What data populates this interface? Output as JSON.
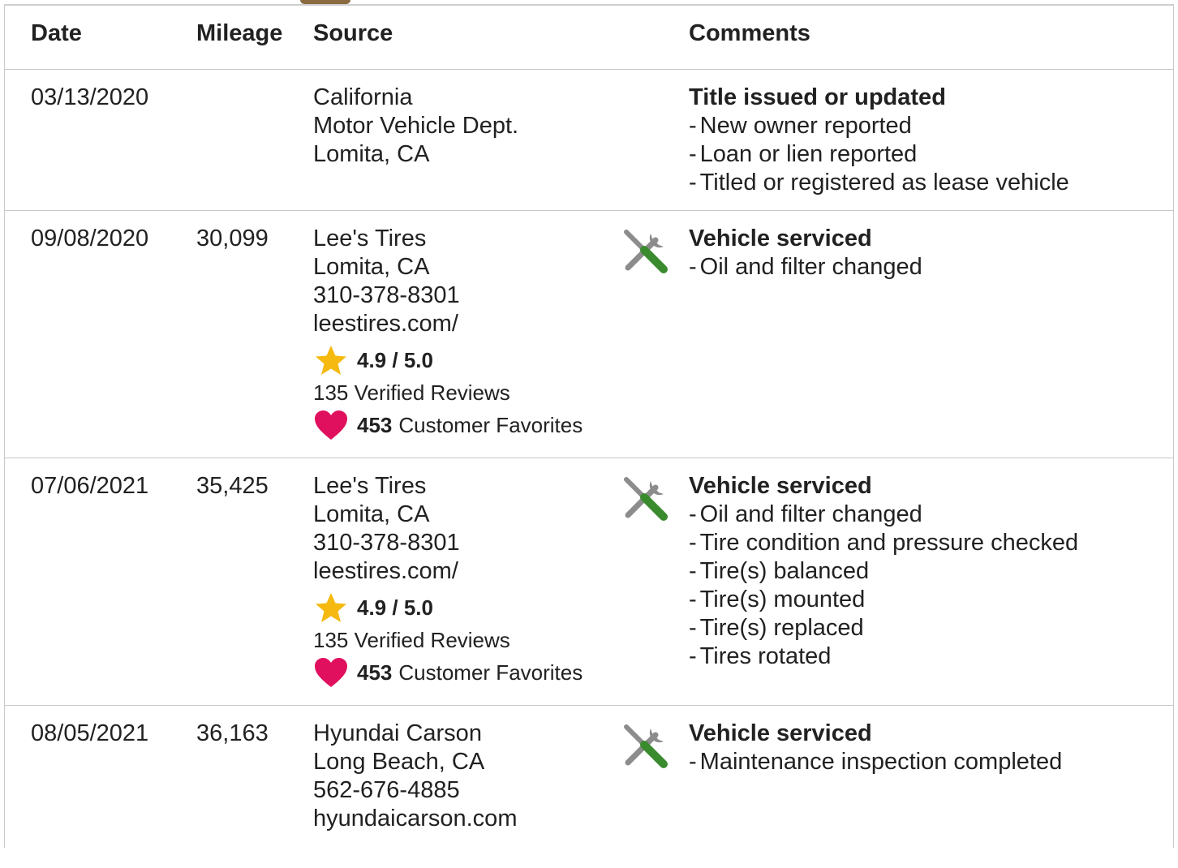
{
  "header": {
    "date": "Date",
    "mileage": "Mileage",
    "source": "Source",
    "comments": "Comments"
  },
  "records": [
    {
      "date": "03/13/2020",
      "mileage": "",
      "source": [
        "California",
        "Motor Vehicle Dept.",
        "Lomita, CA"
      ],
      "title": "Title issued or updated",
      "items": [
        "New owner reported",
        "Loan or lien reported",
        "Titled or registered as lease vehicle"
      ]
    },
    {
      "date": "09/08/2020",
      "mileage": "30,099",
      "source": [
        "Lee's Tires",
        "Lomita, CA",
        "310-378-8301",
        "leestires.com/"
      ],
      "rating": "4.9 / 5.0",
      "reviews": "135 Verified Reviews",
      "favorites_count": "453",
      "favorites_label": "Customer Favorites",
      "title": "Vehicle serviced",
      "items": [
        "Oil and filter changed"
      ]
    },
    {
      "date": "07/06/2021",
      "mileage": "35,425",
      "source": [
        "Lee's Tires",
        "Lomita, CA",
        "310-378-8301",
        "leestires.com/"
      ],
      "rating": "4.9 / 5.0",
      "reviews": "135 Verified Reviews",
      "favorites_count": "453",
      "favorites_label": "Customer Favorites",
      "title": "Vehicle serviced",
      "items": [
        "Oil and filter changed",
        "Tire condition and pressure checked",
        "Tire(s) balanced",
        "Tire(s) mounted",
        "Tire(s) replaced",
        "Tires rotated"
      ]
    },
    {
      "date": "08/05/2021",
      "mileage": "36,163",
      "source": [
        "Hyundai Carson",
        "Long Beach, CA",
        "562-676-4885",
        "hyundaicarson.com"
      ],
      "title": "Vehicle serviced",
      "items": [
        "Maintenance inspection completed"
      ]
    }
  ],
  "item_prefix": "-",
  "icons": {
    "star": "star-icon",
    "heart": "heart-icon",
    "service": "wrench-screwdriver-icon"
  },
  "colors": {
    "star": "#f5b90f",
    "heart": "#e0105e",
    "tool_gray": "#8c8c8c",
    "tool_green": "#3a8a2e"
  }
}
